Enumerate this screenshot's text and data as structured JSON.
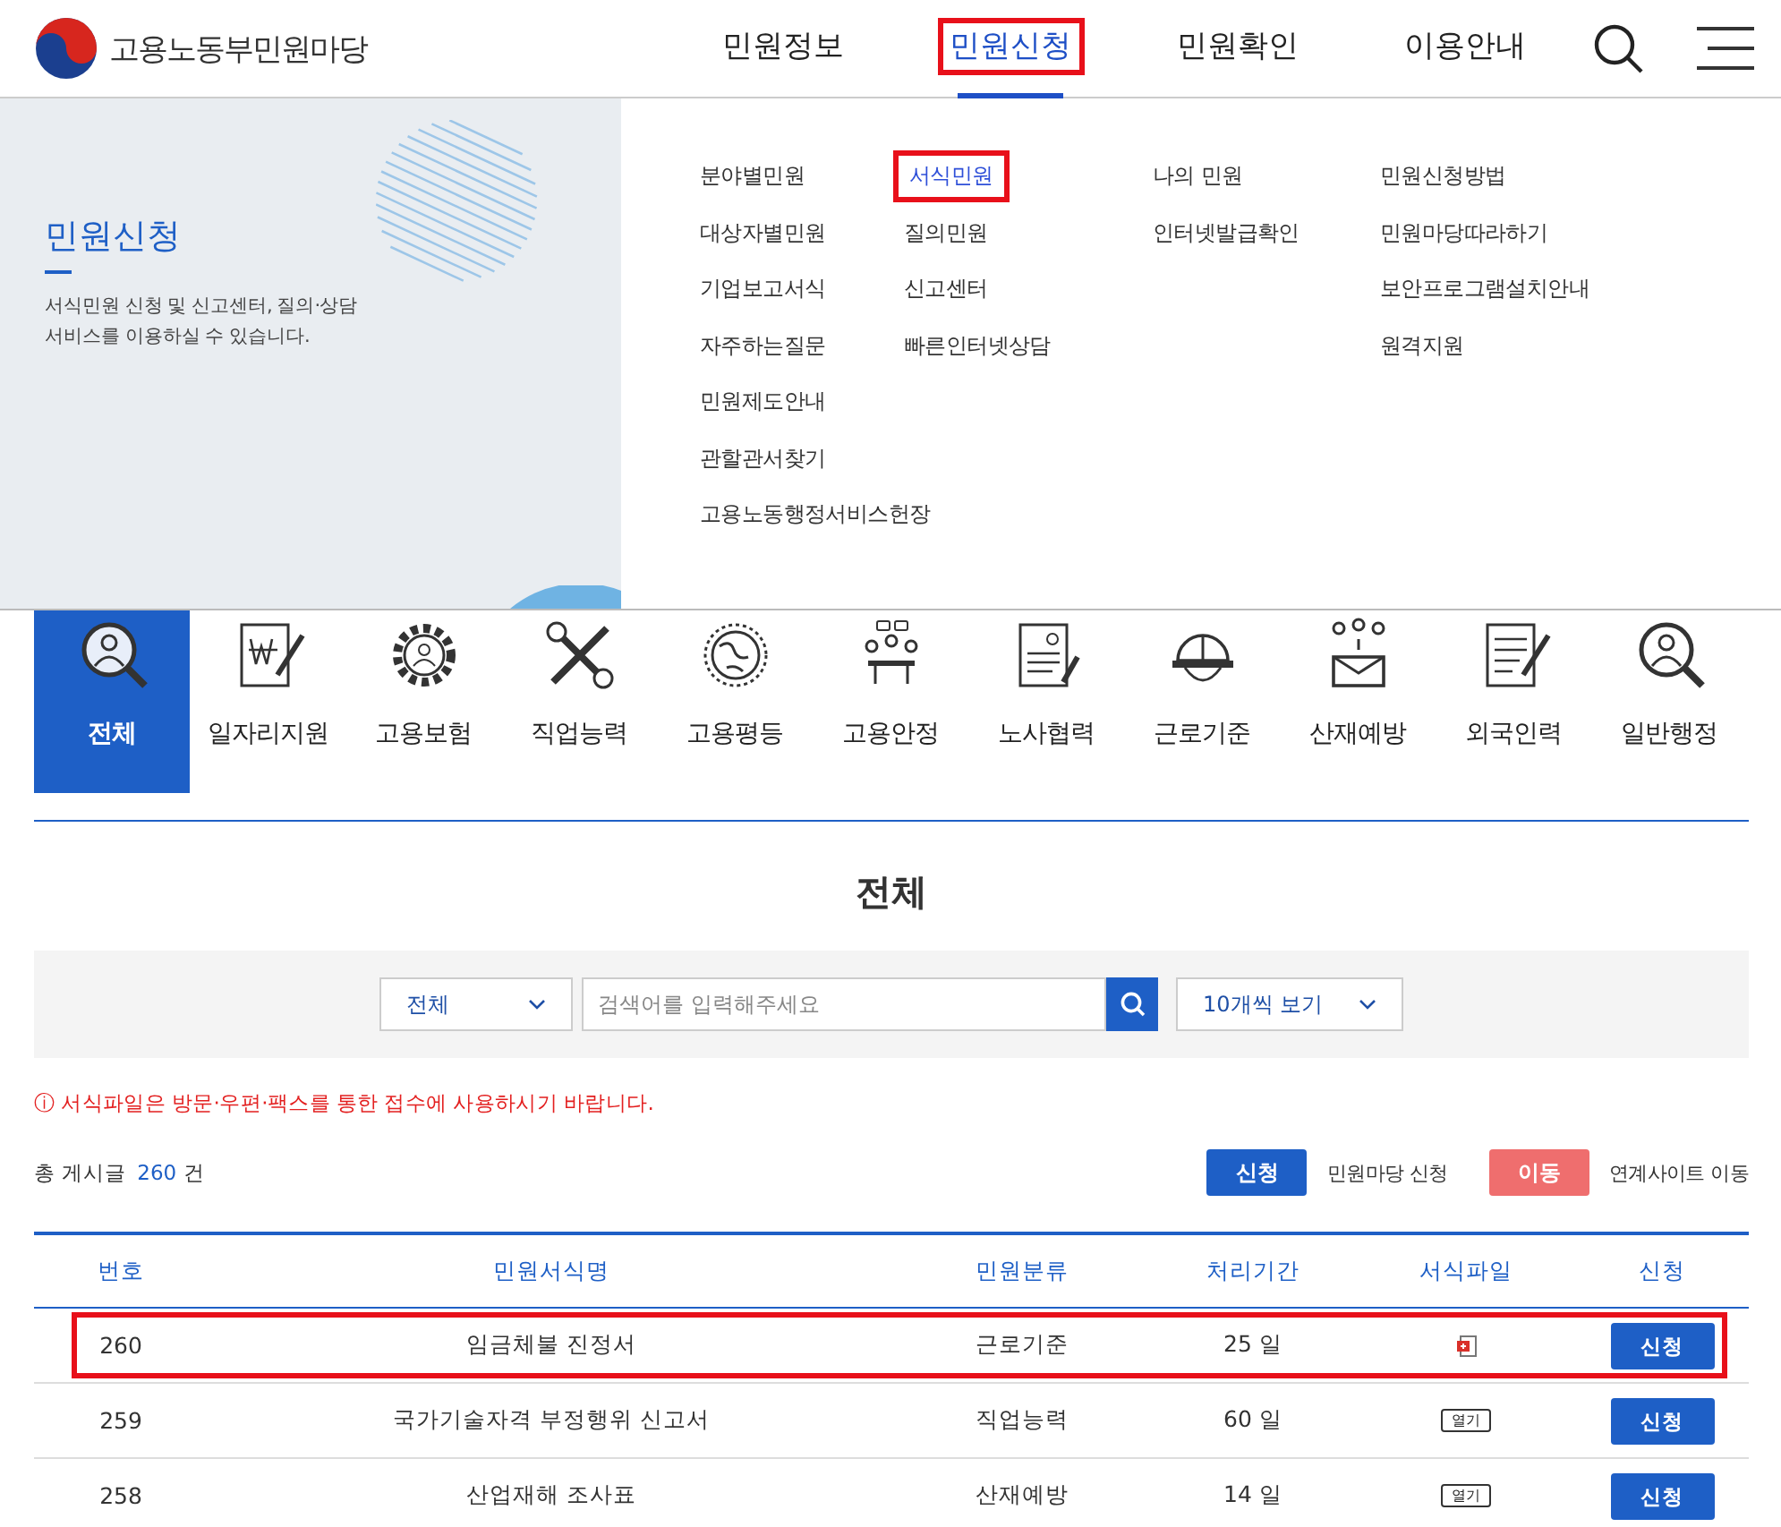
{
  "header": {
    "logo_text": "고용노동부민원마당",
    "nav": [
      {
        "label": "민원정보",
        "selected": false,
        "highlighted": false
      },
      {
        "label": "민원신청",
        "selected": true,
        "highlighted": true
      },
      {
        "label": "민원확인",
        "selected": false,
        "highlighted": false
      },
      {
        "label": "이용안내",
        "selected": false,
        "highlighted": false
      }
    ]
  },
  "mega_menu": {
    "title": "민원신청",
    "description": "서식민원 신청 및 신고센터, 질의·상담\n서비스를 이용하실 수 있습니다.",
    "columns": [
      [
        {
          "label": "분야별민원",
          "selected": false,
          "highlighted": false
        },
        {
          "label": "대상자별민원",
          "selected": false,
          "highlighted": false
        },
        {
          "label": "기업보고서식",
          "selected": false,
          "highlighted": false
        },
        {
          "label": "자주하는질문",
          "selected": false,
          "highlighted": false
        },
        {
          "label": "민원제도안내",
          "selected": false,
          "highlighted": false
        },
        {
          "label": "관할관서찾기",
          "selected": false,
          "highlighted": false
        },
        {
          "label": "고용노동행정서비스헌장",
          "selected": false,
          "highlighted": false
        }
      ],
      [
        {
          "label": "서식민원",
          "selected": true,
          "highlighted": true
        },
        {
          "label": "질의민원",
          "selected": false,
          "highlighted": false
        },
        {
          "label": "신고센터",
          "selected": false,
          "highlighted": false
        },
        {
          "label": "빠른인터넷상담",
          "selected": false,
          "highlighted": false
        }
      ],
      [
        {
          "label": "나의 민원",
          "selected": false,
          "highlighted": false
        },
        {
          "label": "인터넷발급확인",
          "selected": false,
          "highlighted": false
        }
      ],
      [
        {
          "label": "민원신청방법",
          "selected": false,
          "highlighted": false
        },
        {
          "label": "민원마당따라하기",
          "selected": false,
          "highlighted": false
        },
        {
          "label": "보안프로그램설치안내",
          "selected": false,
          "highlighted": false
        },
        {
          "label": "원격지원",
          "selected": false,
          "highlighted": false
        }
      ]
    ]
  },
  "categories": [
    {
      "label": "전체",
      "selected": true
    },
    {
      "label": "일자리지원",
      "selected": false
    },
    {
      "label": "고용보험",
      "selected": false
    },
    {
      "label": "직업능력",
      "selected": false
    },
    {
      "label": "고용평등",
      "selected": false
    },
    {
      "label": "고용안정",
      "selected": false
    },
    {
      "label": "노사협력",
      "selected": false
    },
    {
      "label": "근로기준",
      "selected": false
    },
    {
      "label": "산재예방",
      "selected": false
    },
    {
      "label": "외국인력",
      "selected": false
    },
    {
      "label": "일반행정",
      "selected": false
    }
  ],
  "board": {
    "title": "전체",
    "search": {
      "scope": "전체",
      "placeholder": "검색어를 입력해주세요",
      "page_size": "10개씩 보기"
    },
    "notice": "ⓘ 서식파일은 방문·우편·팩스를 통한 접수에 사용하시기 바랍니다.",
    "total": {
      "prefix": "총 게시글",
      "count": "260",
      "suffix": "건"
    },
    "legend": [
      {
        "kind": "apply",
        "button": "신청",
        "text": "민원마당 신청"
      },
      {
        "kind": "move",
        "button": "이동",
        "text": "연계사이트 이동"
      }
    ],
    "table": {
      "columns": [
        "번호",
        "민원서식명",
        "민원분류",
        "처리기간",
        "서식파일",
        "신청"
      ],
      "rows": [
        {
          "number": "260",
          "name": "임금체불 진정서",
          "category": "근로기준",
          "period": "25 일",
          "file": {
            "kind": "document"
          },
          "action": "신청",
          "highlighted": true
        },
        {
          "number": "259",
          "name": "국가기술자격 부정행위 신고서",
          "category": "직업능력",
          "period": "60 일",
          "file": {
            "kind": "open",
            "label": "열기"
          },
          "action": "신청",
          "highlighted": false
        },
        {
          "number": "258",
          "name": "산업재해 조사표",
          "category": "산재예방",
          "period": "14 일",
          "file": {
            "kind": "open",
            "label": "열기"
          },
          "action": "신청",
          "highlighted": false
        }
      ]
    }
  }
}
